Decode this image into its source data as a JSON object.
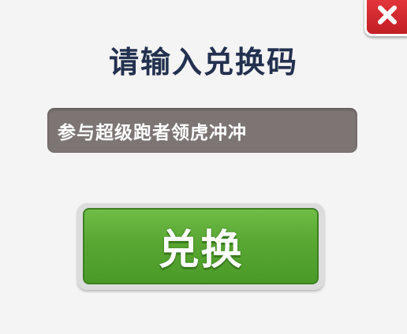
{
  "dialog": {
    "title": "请输入兑换码",
    "code_input": {
      "value": "参与超级跑者领虎冲冲"
    },
    "redeem_button_label": "兑换"
  },
  "colors": {
    "title": "#23304f",
    "input_bg": "#7d7574",
    "button_green": "#59a733",
    "close_red": "#d22a30"
  },
  "icons": {
    "close": "close-icon"
  }
}
